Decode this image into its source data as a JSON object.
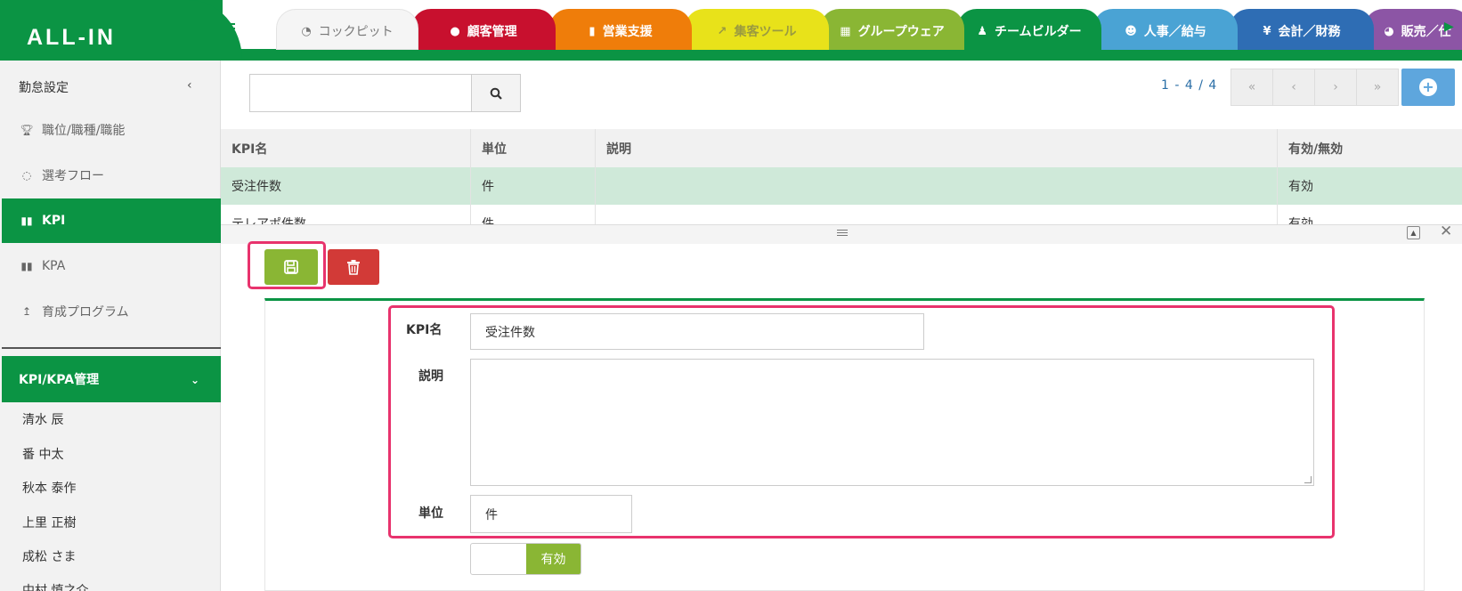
{
  "app": {
    "logo": "ALL-IN"
  },
  "tabs": [
    {
      "label": "コックピット",
      "icon": "dashboard-icon",
      "color": "#f5f5f5",
      "text_color": "#777"
    },
    {
      "label": "顧客管理",
      "icon": "comments-icon",
      "color": "#c8102e",
      "text_color": "#ffffff"
    },
    {
      "label": "営業支援",
      "icon": "bar-chart-icon",
      "color": "#ef7d0a",
      "text_color": "#ffffff"
    },
    {
      "label": "集客ツール",
      "icon": "line-chart-icon",
      "color": "#e8e21a",
      "text_color": "#9a9a40"
    },
    {
      "label": "グループウェア",
      "icon": "calendar-icon",
      "color": "#8ab634",
      "text_color": "#ffffff"
    },
    {
      "label": "チームビルダー",
      "icon": "user-plus-icon",
      "color": "#0b9444",
      "text_color": "#ffffff"
    },
    {
      "label": "人事／給与",
      "icon": "users-icon",
      "color": "#4aa3d4",
      "text_color": "#ffffff"
    },
    {
      "label": "会計／財務",
      "icon": "yen-icon",
      "color": "#2e6db4",
      "text_color": "#ffffff"
    },
    {
      "label": "販売／仕",
      "icon": "pie-chart-icon",
      "color": "#8c55a5",
      "text_color": "#ffffff"
    }
  ],
  "sidebar": {
    "header": "勤怠設定",
    "items": [
      {
        "label": "職位/職種/職能",
        "icon": "trophy-icon"
      },
      {
        "label": "選考フロー",
        "icon": "comments-icon"
      },
      {
        "label": "KPI",
        "icon": "bar-chart-icon",
        "active": true
      },
      {
        "label": "KPA",
        "icon": "bar-chart-icon"
      },
      {
        "label": "育成プログラム",
        "icon": "arrow-up-icon"
      }
    ],
    "section_title": "KPI/KPA管理",
    "users": [
      "清水 辰",
      "番 中太",
      "秋本 泰作",
      "上里 正樹",
      "成松 さま",
      "中村 慎之介"
    ]
  },
  "search": {
    "value": ""
  },
  "pager": {
    "text": "1 - 4 / 4",
    "first": "«",
    "prev": "‹",
    "next": "›",
    "last": "»"
  },
  "grid": {
    "columns": [
      "KPI名",
      "単位",
      "説明",
      "有効/無効"
    ],
    "rows": [
      [
        "受注件数",
        "件",
        "",
        "有効"
      ],
      [
        "テレアポ件数",
        "件",
        "",
        "有効"
      ]
    ]
  },
  "form": {
    "kpi_name_label": "KPI名",
    "kpi_name_value": "受注件数",
    "description_label": "説明",
    "description_value": "",
    "unit_label": "単位",
    "unit_value": "件",
    "toggle_label": "有効"
  }
}
